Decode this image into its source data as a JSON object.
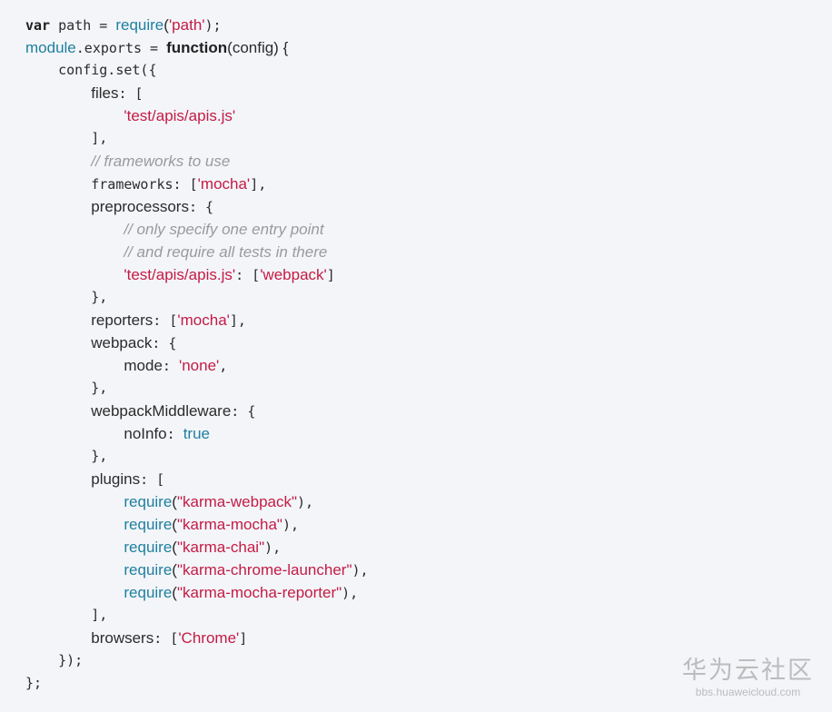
{
  "code": {
    "language": "javascript",
    "lines": [
      [
        {
          "t": "var",
          "k": "kw mono"
        },
        {
          "t": " path = ",
          "k": "plain mono"
        },
        {
          "t": "require",
          "k": "fn sans"
        },
        {
          "t": "(",
          "k": "plain sans"
        },
        {
          "t": "'path'",
          "k": "str sans"
        },
        {
          "t": ");",
          "k": "plain mono"
        }
      ],
      [
        {
          "t": "module",
          "k": "fn sans"
        },
        {
          "t": ".exports = ",
          "k": "plain mono"
        },
        {
          "t": "function",
          "k": "kw sans"
        },
        {
          "t": "(config) {",
          "k": "plain sans"
        }
      ],
      [
        {
          "t": "    config.set({",
          "k": "plain mono"
        }
      ],
      [
        {
          "t": "        ",
          "k": "plain mono"
        },
        {
          "t": "files",
          "k": "plain sans"
        },
        {
          "t": ": [",
          "k": "plain mono"
        }
      ],
      [
        {
          "t": "            ",
          "k": "plain mono"
        },
        {
          "t": "'test/apis/apis.js'",
          "k": "str sans"
        }
      ],
      [
        {
          "t": "        ],",
          "k": "plain mono"
        }
      ],
      [
        {
          "t": "        ",
          "k": "plain mono"
        },
        {
          "t": "// frameworks to use",
          "k": "comment sans"
        }
      ],
      [
        {
          "t": "        frameworks: [",
          "k": "plain mono"
        },
        {
          "t": "'mocha'",
          "k": "str sans"
        },
        {
          "t": "],",
          "k": "plain mono"
        }
      ],
      [
        {
          "t": "        ",
          "k": "plain mono"
        },
        {
          "t": "preprocessors",
          "k": "plain sans"
        },
        {
          "t": ": {",
          "k": "plain mono"
        }
      ],
      [
        {
          "t": "            ",
          "k": "plain mono"
        },
        {
          "t": "// only specify one entry point",
          "k": "comment sans"
        }
      ],
      [
        {
          "t": "            ",
          "k": "plain mono"
        },
        {
          "t": "// and require all tests in there",
          "k": "comment sans"
        }
      ],
      [
        {
          "t": "            ",
          "k": "plain mono"
        },
        {
          "t": "'test/apis/apis.js'",
          "k": "str sans"
        },
        {
          "t": ": [",
          "k": "plain mono"
        },
        {
          "t": "'webpack'",
          "k": "str sans"
        },
        {
          "t": "]",
          "k": "plain mono"
        }
      ],
      [
        {
          "t": "        },",
          "k": "plain mono"
        }
      ],
      [
        {
          "t": "        ",
          "k": "plain mono"
        },
        {
          "t": "reporters",
          "k": "plain sans"
        },
        {
          "t": ": [",
          "k": "plain mono"
        },
        {
          "t": "'mocha'",
          "k": "str sans"
        },
        {
          "t": "],",
          "k": "plain mono"
        }
      ],
      [
        {
          "t": "        ",
          "k": "plain mono"
        },
        {
          "t": "webpack",
          "k": "plain sans"
        },
        {
          "t": ": {",
          "k": "plain mono"
        }
      ],
      [
        {
          "t": "            ",
          "k": "plain mono"
        },
        {
          "t": "mode",
          "k": "plain sans"
        },
        {
          "t": ": ",
          "k": "plain mono"
        },
        {
          "t": "'none'",
          "k": "str sans"
        },
        {
          "t": ",",
          "k": "plain mono"
        }
      ],
      [
        {
          "t": "        },",
          "k": "plain mono"
        }
      ],
      [
        {
          "t": "        ",
          "k": "plain mono"
        },
        {
          "t": "webpackMiddleware",
          "k": "plain sans"
        },
        {
          "t": ": {",
          "k": "plain mono"
        }
      ],
      [
        {
          "t": "            ",
          "k": "plain mono"
        },
        {
          "t": "noInfo",
          "k": "plain sans"
        },
        {
          "t": ": ",
          "k": "plain mono"
        },
        {
          "t": "true",
          "k": "bool sans"
        }
      ],
      [
        {
          "t": "        },",
          "k": "plain mono"
        }
      ],
      [
        {
          "t": "        ",
          "k": "plain mono"
        },
        {
          "t": "plugins",
          "k": "plain sans"
        },
        {
          "t": ": [",
          "k": "plain mono"
        }
      ],
      [
        {
          "t": "            ",
          "k": "plain mono"
        },
        {
          "t": "require",
          "k": "fn sans"
        },
        {
          "t": "(",
          "k": "plain sans"
        },
        {
          "t": "\"karma-webpack\"",
          "k": "str sans"
        },
        {
          "t": "),",
          "k": "plain mono"
        }
      ],
      [
        {
          "t": "            ",
          "k": "plain mono"
        },
        {
          "t": "require",
          "k": "fn sans"
        },
        {
          "t": "(",
          "k": "plain sans"
        },
        {
          "t": "\"karma-mocha\"",
          "k": "str sans"
        },
        {
          "t": "),",
          "k": "plain mono"
        }
      ],
      [
        {
          "t": "            ",
          "k": "plain mono"
        },
        {
          "t": "require",
          "k": "fn sans"
        },
        {
          "t": "(",
          "k": "plain sans"
        },
        {
          "t": "\"karma-chai\"",
          "k": "str sans"
        },
        {
          "t": "),",
          "k": "plain mono"
        }
      ],
      [
        {
          "t": "            ",
          "k": "plain mono"
        },
        {
          "t": "require",
          "k": "fn sans"
        },
        {
          "t": "(",
          "k": "plain sans"
        },
        {
          "t": "\"karma-chrome-launcher\"",
          "k": "str sans"
        },
        {
          "t": "),",
          "k": "plain mono"
        }
      ],
      [
        {
          "t": "            ",
          "k": "plain mono"
        },
        {
          "t": "require",
          "k": "fn sans"
        },
        {
          "t": "(",
          "k": "plain sans"
        },
        {
          "t": "\"karma-mocha-reporter\"",
          "k": "str sans"
        },
        {
          "t": "),",
          "k": "plain mono"
        }
      ],
      [
        {
          "t": "        ],",
          "k": "plain mono"
        }
      ],
      [
        {
          "t": "        ",
          "k": "plain mono"
        },
        {
          "t": "browsers",
          "k": "plain sans"
        },
        {
          "t": ": [",
          "k": "plain mono"
        },
        {
          "t": "'Chrome'",
          "k": "str sans"
        },
        {
          "t": "]",
          "k": "plain mono"
        }
      ],
      [
        {
          "t": "    });",
          "k": "plain mono"
        }
      ],
      [
        {
          "t": "};",
          "k": "plain mono"
        }
      ]
    ]
  },
  "colors": {
    "background": "#f3f5f9",
    "keyword": "#1f1f1f",
    "function": "#1f7f9f",
    "string": "#c41b44",
    "comment": "#9a9a9a",
    "plain": "#2b2b2b",
    "watermark": "#bcbcbc"
  },
  "watermark": {
    "title": "华为云社区",
    "url": "bbs.huaweicloud.com"
  }
}
